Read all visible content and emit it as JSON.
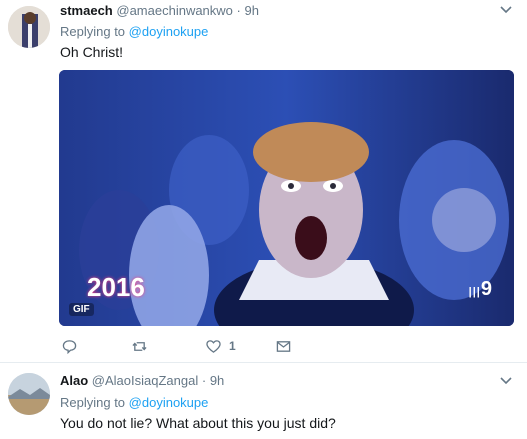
{
  "tweets": [
    {
      "name": "stmaech",
      "handle": "@amaechinwankwo",
      "separator": "·",
      "time": "9h",
      "reply_prefix": "Replying to",
      "reply_mention": "@doyinokupe",
      "text": "Oh Christ!",
      "media": {
        "badge": "GIF",
        "overlay_logo": "2016",
        "overlay_channel": "9"
      },
      "actions": {
        "reply_icon": "reply-icon",
        "retweet_icon": "retweet-icon",
        "like_icon": "heart-icon",
        "like_count": "1",
        "message_icon": "envelope-icon"
      }
    },
    {
      "name": "Alao",
      "handle": "@AlaoIsiaqZangal",
      "separator": "·",
      "time": "9h",
      "reply_prefix": "Replying to",
      "reply_mention": "@doyinokupe",
      "text": "You do not lie? What about this you just did?"
    }
  ],
  "colors": {
    "link": "#1da1f2",
    "muted": "#657786",
    "text": "#14171a",
    "divider": "#e6ecf0"
  }
}
